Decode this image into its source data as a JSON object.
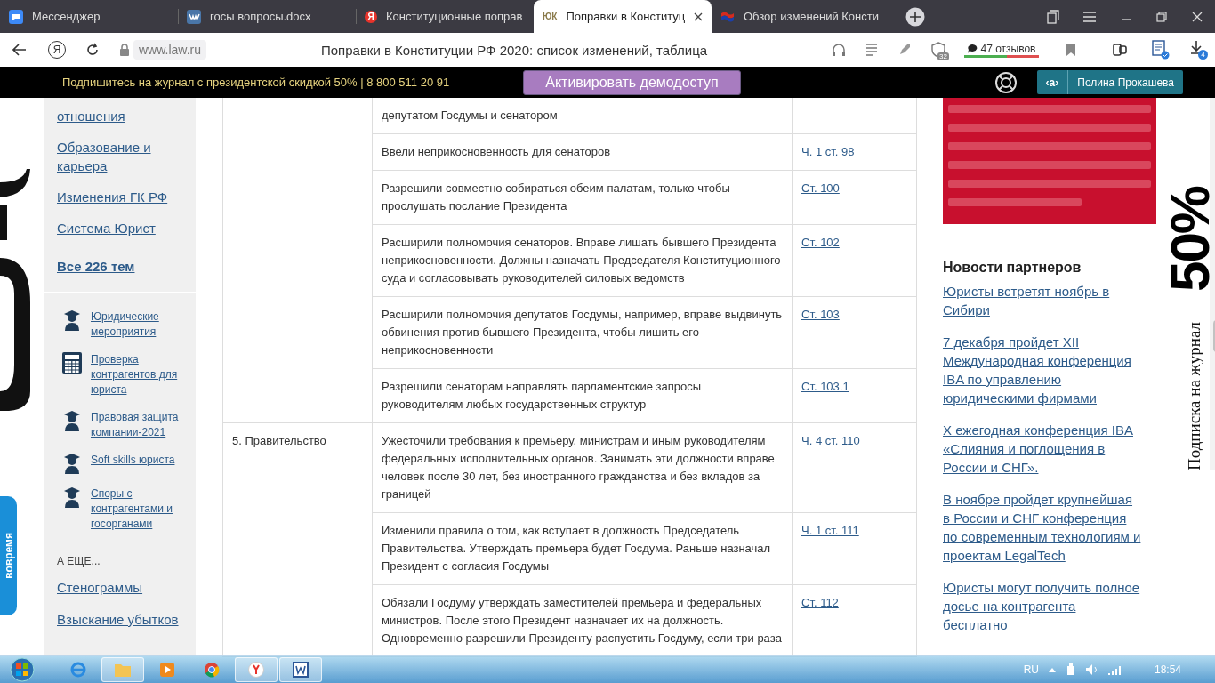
{
  "browser": {
    "tabs": [
      {
        "kind": "messenger",
        "label": "Мессенджер",
        "selected": false
      },
      {
        "kind": "vk",
        "label": "госы вопросы.docx",
        "selected": false
      },
      {
        "kind": "letter",
        "badge": "Я",
        "label": "Конституционные поправ",
        "selected": false
      },
      {
        "kind": "letter",
        "badge": "ЮК",
        "label": "Поправки в Конституц",
        "selected": true
      },
      {
        "kind": "flag",
        "label": "Обзор изменений Консти",
        "selected": false
      }
    ],
    "logo": "Я",
    "url": "www.law.ru",
    "page_title": "Поправки в Конституции РФ 2020: список изменений, таблица",
    "shield_count": "32",
    "reviews": "47 отзывов",
    "downloads_count": "4"
  },
  "banner": {
    "promo": "Подпишитесь на журнал с президентской скидкой 50% | 8 800 511 20 91",
    "button": "Активировать демодоступ",
    "user_mark": "‹a›",
    "user": "Полина Прокашева"
  },
  "side_branding": {
    "tab": "вовремя",
    "big": "50%",
    "caption": "Подписка на журнал"
  },
  "sidebar": {
    "links": [
      {
        "label": "отношения",
        "bold": false
      },
      {
        "label": "Образование и карьера",
        "bold": false
      },
      {
        "label": "Изменения ГК РФ",
        "bold": false
      },
      {
        "label": "Система Юрист",
        "bold": false
      },
      {
        "label": "Все 226 тем",
        "bold": true
      }
    ],
    "services": [
      {
        "kind": "course",
        "label": "Юридические мероприятия"
      },
      {
        "kind": "tool",
        "label": "Проверка контрагентов для юриста"
      },
      {
        "kind": "course",
        "label": "Правовая защита компании-2021"
      },
      {
        "kind": "course",
        "label": "Soft skills юриста"
      },
      {
        "kind": "course",
        "label": "Споры с контрагентами и госорганами"
      }
    ],
    "more_heading": "А ЕЩЕ...",
    "more": [
      "Стенограммы",
      "Взыскание убытков"
    ]
  },
  "table": {
    "sections": [
      {
        "rows": [
          {
            "change": "депутатом Госдумы и сенатором"
          },
          {
            "change": "Ввели неприкосновенность для сенаторов",
            "ref": "Ч. 1 ст. 98"
          },
          {
            "change": "Разрешили совместно собираться обеим палатам, только чтобы прослушать послание Президента",
            "ref": "Ст. 100"
          },
          {
            "change": "Расширили полномочия сенаторов. Вправе лишать бывшего Президента неприкосновенности. Должны назначать Председателя Конституционного суда и согласовывать руководителей силовых ведомств",
            "ref": "Ст. 102"
          },
          {
            "change": "Расширили полномочия депутатов Госдумы, например, вправе выдвинуть обвинения против бывшего Президента, чтобы лишить его неприкосновенности",
            "ref": "Ст. 103"
          },
          {
            "change": "Разрешили сенаторам направлять парламентские запросы руководителям любых государственных структур",
            "ref": "Ст. 103.1"
          }
        ]
      },
      {
        "title": "5. Правительство",
        "rows": [
          {
            "change": "Ужесточили требования к премьеру, министрам и иным руководителям федеральных исполнительных органов. Занимать эти должности вправе человек после 30 лет, без иностранного гражданства и без вкладов за границей",
            "ref": "Ч. 4 ст. 110"
          },
          {
            "change": "Изменили правила о том, как вступает в должность Председатель Правительства. Утверждать премьера будет Госдума. Раньше назначал Президент с согласия Госдумы",
            "ref": "Ч. 1 ст. 111"
          },
          {
            "change": "Обязали Госдуму утверждать заместителей премьера и федеральных министров. После этого Президент назначает их на должность. Одновременно разрешили Президенту распустить Госдуму, если три раза",
            "ref": "Ст. 112"
          }
        ]
      }
    ]
  },
  "news": {
    "heading": "Новости партнеров",
    "items": [
      "Юристы встретят ноябрь в Сибири",
      "7 декабря пройдет XII Международная конференция IBA по управлению юридическими фирмами",
      "X ежегодная конференция IBA «Слияния и поглощения в России и СНГ».",
      "В ноябре пройдет крупнейшая в России и СНГ конференция по современным технологиям и проектам LegalTech",
      "Юристы могут получить полное досье на контрагента бесплатно"
    ]
  },
  "taskbar": {
    "apps": [
      {
        "kind": "ie",
        "selected": false
      },
      {
        "kind": "folder",
        "selected": true
      },
      {
        "kind": "player",
        "selected": false
      },
      {
        "kind": "chrome",
        "selected": false
      },
      {
        "kind": "yandex",
        "selected": true
      },
      {
        "kind": "word",
        "selected": true
      }
    ],
    "lang": "RU",
    "time": "18:54"
  }
}
